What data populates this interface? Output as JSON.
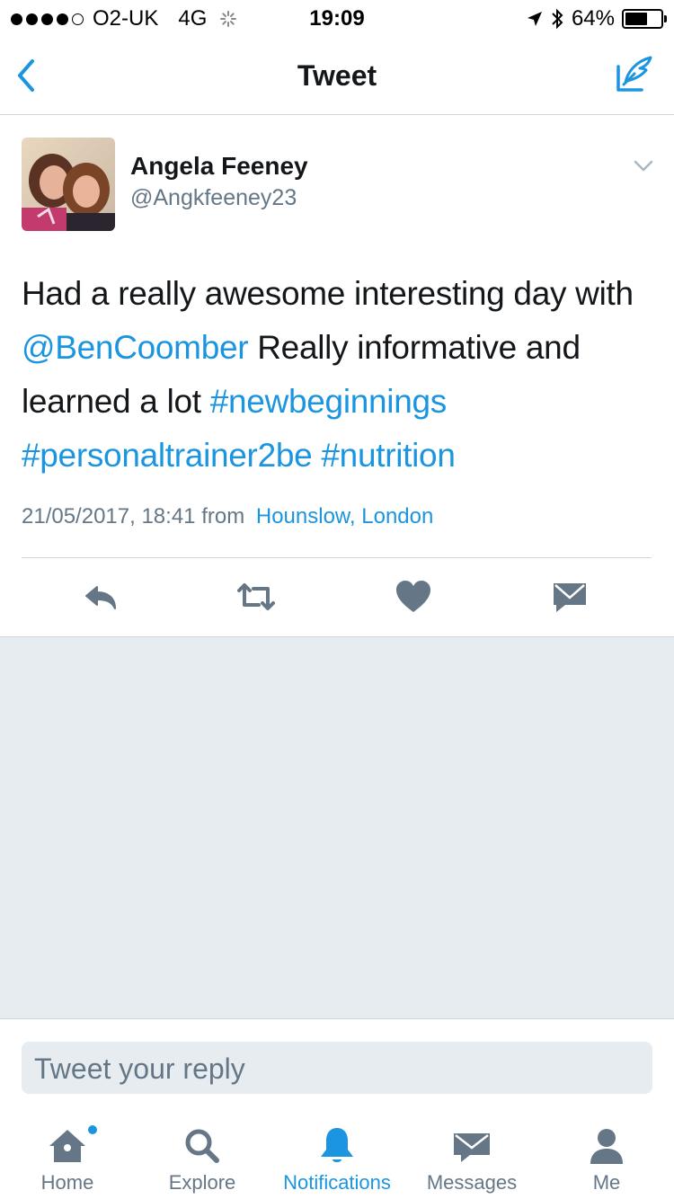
{
  "status_bar": {
    "carrier": "O2-UK",
    "network": "4G",
    "time": "19:09",
    "battery_percent": "64%",
    "battery_level": 0.64
  },
  "nav": {
    "title": "Tweet",
    "back_icon": "chevron-left-icon",
    "compose_icon": "compose-tweet-icon",
    "accent_color": "#1b95e0"
  },
  "tweet": {
    "author_name": "Angela Feeney",
    "author_handle": "@Angkfeeney23",
    "text_parts": [
      {
        "text": "Had a really awesome interesting day with ",
        "link": false
      },
      {
        "text": "@BenCoomber",
        "link": true
      },
      {
        "text": " Really informative and learned a lot ",
        "link": false
      },
      {
        "text": "#newbeginnings",
        "link": true
      },
      {
        "text": " ",
        "link": false
      },
      {
        "text": "#personaltrainer2be",
        "link": true
      },
      {
        "text": " ",
        "link": false
      },
      {
        "text": "#nutrition",
        "link": true
      }
    ],
    "timestamp": "21/05/2017, 18:41",
    "from_label": "from",
    "location": "Hounslow, London",
    "actions": [
      "reply-icon",
      "retweet-icon",
      "like-icon",
      "direct-message-icon"
    ]
  },
  "reply": {
    "placeholder": "Tweet your reply"
  },
  "tabs": [
    {
      "label": "Home",
      "icon": "home-icon",
      "active": false
    },
    {
      "label": "Explore",
      "icon": "search-icon",
      "active": false
    },
    {
      "label": "Notifications",
      "icon": "bell-icon",
      "active": true
    },
    {
      "label": "Messages",
      "icon": "envelope-icon",
      "active": false
    },
    {
      "label": "Me",
      "icon": "person-icon",
      "active": false
    }
  ]
}
